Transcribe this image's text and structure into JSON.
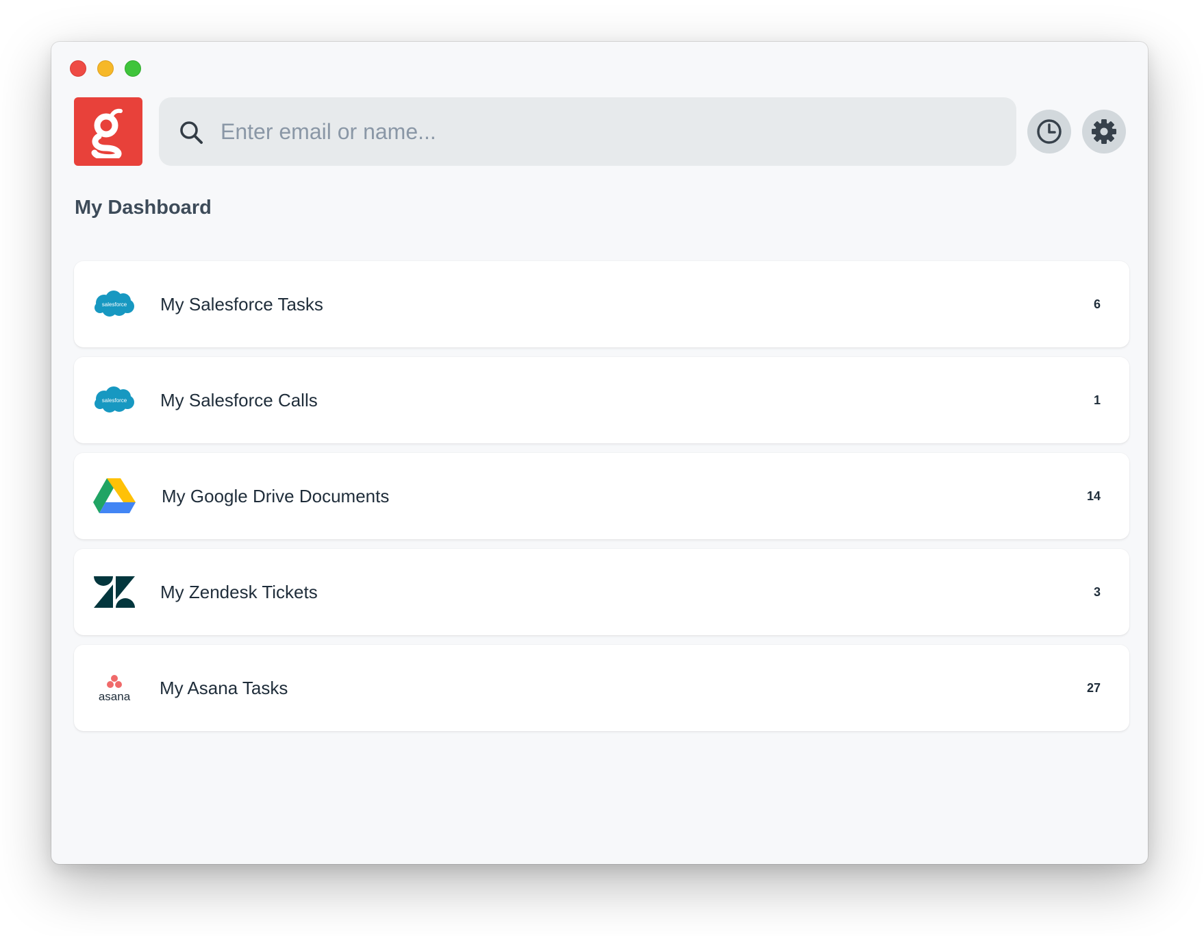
{
  "window": {
    "buttons": [
      "close",
      "minimize",
      "maximize"
    ]
  },
  "header": {
    "logo_icon": "g-logo-icon",
    "search": {
      "placeholder": "Enter email or name...",
      "value": "",
      "icon": "search-icon"
    },
    "history_icon": "clock-icon",
    "settings_icon": "gear-icon"
  },
  "dashboard": {
    "title": "My Dashboard",
    "items": [
      {
        "label": "My Salesforce Tasks",
        "count": "6",
        "icon": "salesforce-icon",
        "icon_text": "salesforce"
      },
      {
        "label": "My Salesforce Calls",
        "count": "1",
        "icon": "salesforce-icon",
        "icon_text": "salesforce"
      },
      {
        "label": "My Google Drive Documents",
        "count": "14",
        "icon": "google-drive-icon"
      },
      {
        "label": "My Zendesk Tickets",
        "count": "3",
        "icon": "zendesk-icon"
      },
      {
        "label": "My Asana Tasks",
        "count": "27",
        "icon": "asana-icon",
        "icon_text": "asana"
      }
    ]
  },
  "colors": {
    "brand": "#e8413a",
    "window_bg": "#f7f8fa",
    "search_bg": "#e7eaec",
    "text": "#1f2d3a",
    "salesforce": "#1798c1",
    "asana": "#f06a6a",
    "zendesk": "#03363d"
  }
}
